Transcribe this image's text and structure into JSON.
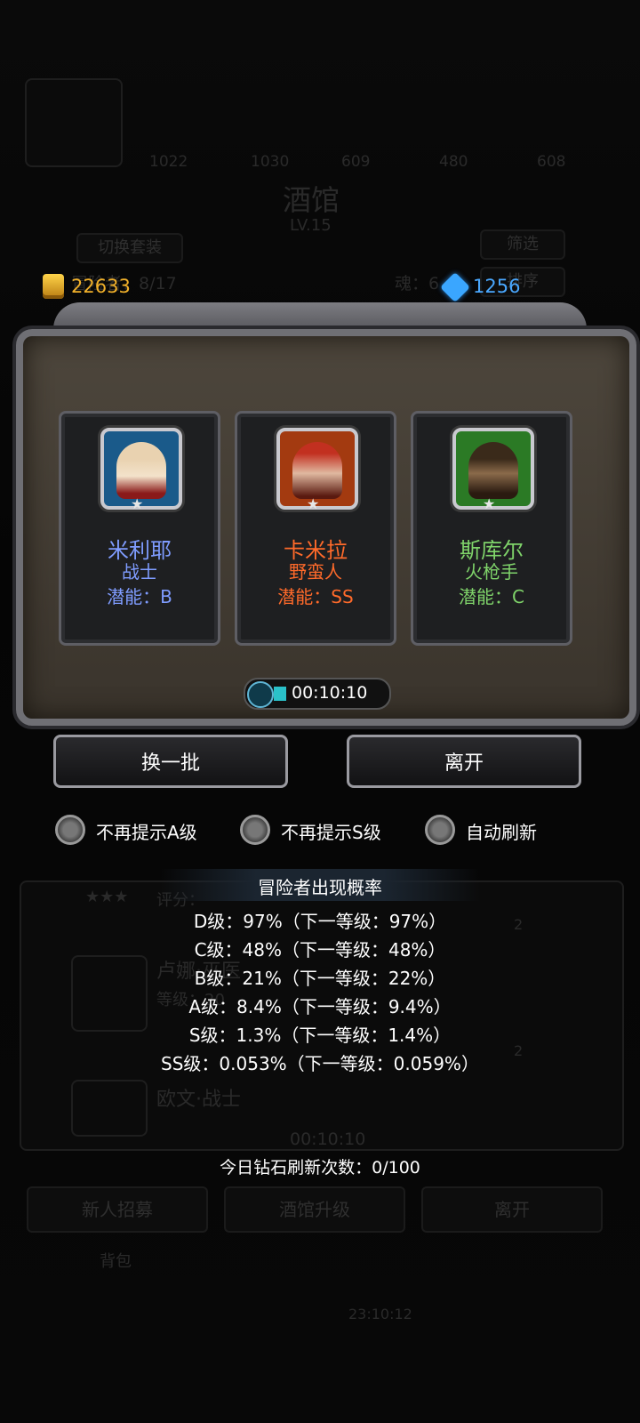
{
  "currency": {
    "gold": "22633",
    "gems": "1256"
  },
  "background": {
    "scene_title": "酒馆",
    "scene_level": "LV.15",
    "switch_outfit": "切换套装",
    "filter": "筛选",
    "sort": "排序",
    "adventurer_count": "冒险者：8/17",
    "soul": "魂：6",
    "stat_values": [
      "1022",
      "1030",
      "609",
      "480",
      "608"
    ],
    "list_stars": "★★★",
    "list_rating": "评分：",
    "list_name_1": "卢娜·巫医",
    "list_level": "等级：20",
    "list_name_2": "欧文·战士",
    "badge": "2",
    "timer_behind": "00:10:10",
    "footer_buttons": [
      "新人招募",
      "酒馆升级",
      "离开"
    ],
    "footer_label": "背包",
    "footer_time": "23:10:12"
  },
  "cards": [
    {
      "name": "米利耶",
      "role": "战士",
      "potential": "潜能：B",
      "color": "#7f9cff"
    },
    {
      "name": "卡米拉",
      "role": "野蛮人",
      "potential": "潜能：SS",
      "color": "#ff6a2a"
    },
    {
      "name": "斯库尔",
      "role": "火枪手",
      "potential": "潜能：C",
      "color": "#7fd36a"
    }
  ],
  "timer": "00:10:10",
  "buttons": {
    "refresh": "换一批",
    "leave": "离开"
  },
  "options": [
    {
      "label": "不再提示A级"
    },
    {
      "label": "不再提示S级"
    },
    {
      "label": "自动刷新"
    }
  ],
  "probability": {
    "title": "冒险者出现概率",
    "lines": [
      "D级：97%（下一等级：97%）",
      "C级：48%（下一等级：48%）",
      "B级：21%（下一等级：22%）",
      "A级：8.4%（下一等级：9.4%）",
      "S级：1.3%（下一等级：1.4%）",
      "SS级：0.053%（下一等级：0.059%）"
    ]
  },
  "daily_refresh": "今日钻石刷新次数：0/100"
}
